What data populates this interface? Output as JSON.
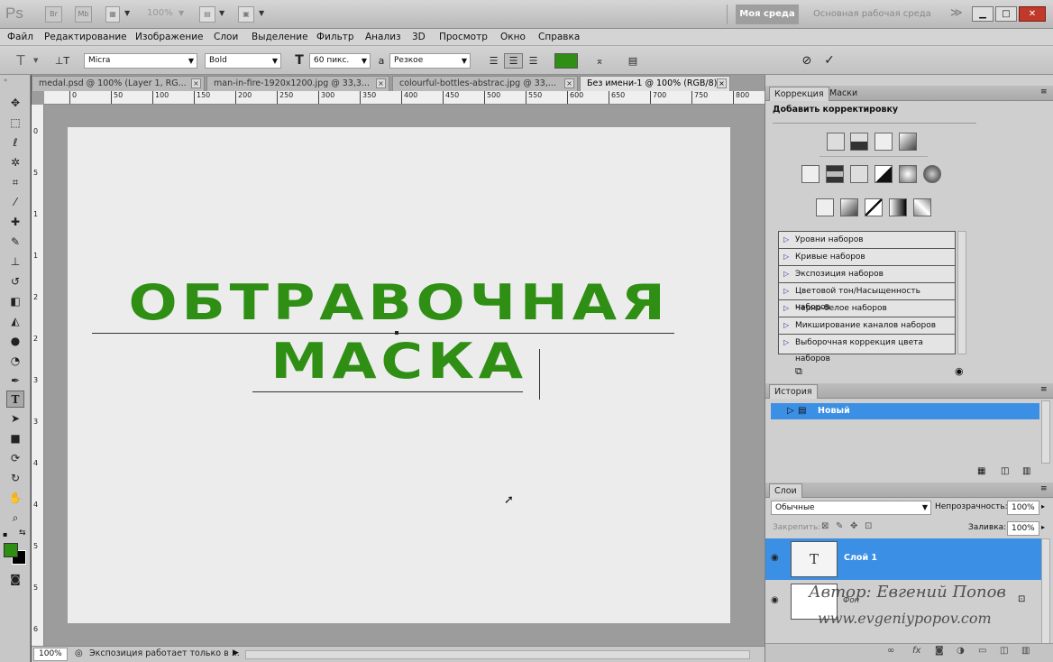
{
  "titlebar": {
    "logo": "Ps",
    "br_label": "Br",
    "mb_label": "Mb",
    "zoom": "100%",
    "workspace_active": "Моя среда",
    "workspace_other": "Основная рабочая среда",
    "more": "≫",
    "min": "▁",
    "max": "□",
    "close": "✕"
  },
  "menu": [
    "Файл",
    "Редактирование",
    "Изображение",
    "Слои",
    "Выделение",
    "Фильтр",
    "Анализ",
    "3D",
    "Просмотр",
    "Окно",
    "Справка"
  ],
  "options": {
    "tool_glyph": "T",
    "orient_glyph": "⊥T",
    "font_family": "Micra",
    "font_style": "Bold",
    "size_glyph": "T",
    "font_size": "60 пикс.",
    "aa_glyph": "a",
    "antialias": "Резкое",
    "text_color": "#2f8f14",
    "cancel": "⊘",
    "commit": "✓"
  },
  "tabs": [
    {
      "label": "medal.psd @ 100% (Layer 1, RG..."
    },
    {
      "label": "man-in-fire-1920x1200.jpg @ 33,3..."
    },
    {
      "label": "colourful-bottles-abstrac.jpg @ 33,..."
    },
    {
      "label": "Без имени-1 @ 100% (RGB/8)"
    }
  ],
  "ruler_marks": [
    "0",
    "50",
    "100",
    "150",
    "200",
    "250",
    "300",
    "350",
    "400",
    "450",
    "500",
    "550",
    "600",
    "650",
    "700",
    "750",
    "800"
  ],
  "ruler_left_marks": [
    "0",
    "5",
    "1",
    "1",
    "2",
    "2",
    "3",
    "3",
    "4",
    "4",
    "5",
    "5",
    "6"
  ],
  "canvas": {
    "line1": "ОБТРАВОЧНАЯ",
    "line2": "МАСКА"
  },
  "status": {
    "zoom": "100%",
    "message": "Экспозиция работает только в ..."
  },
  "foreground_color": "#2f8f14",
  "adjustments": {
    "tab_active": "Коррекция",
    "tab_other": "Маски",
    "heading": "Добавить корректировку",
    "presets": [
      "Уровни наборов",
      "Кривые наборов",
      "Экспозиция наборов",
      "Цветовой тон/Насыщенность наборов",
      "Черно-белое наборов",
      "Микширование каналов наборов",
      "Выборочная коррекция цвета наборов"
    ]
  },
  "history": {
    "tab": "История",
    "item": "Новый"
  },
  "layers": {
    "tab": "Слои",
    "blend_mode": "Обычные",
    "opacity_label": "Непрозрачность:",
    "opacity": "100%",
    "lock_label": "Закрепить:",
    "fill_label": "Заливка:",
    "fill": "100%",
    "items": [
      {
        "name": "Слой 1",
        "thumb": "T"
      },
      {
        "name": "Фон"
      }
    ],
    "fx": "fx"
  },
  "watermark": {
    "line1": "Автор: Евгений Попов",
    "line2": "www.evgeniypopov.com"
  }
}
